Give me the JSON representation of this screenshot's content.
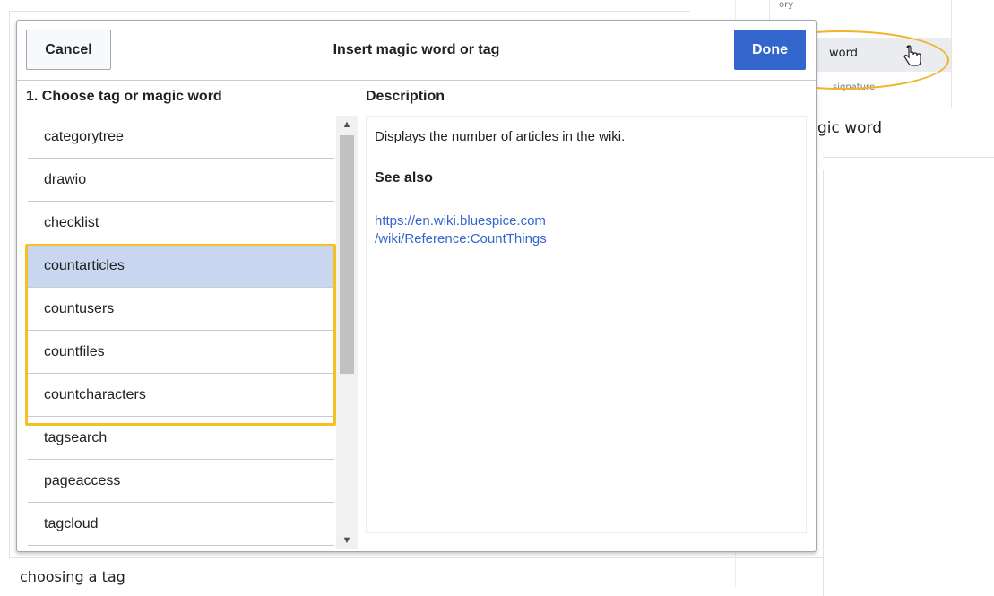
{
  "dialog": {
    "title": "Insert magic word or tag",
    "cancel_label": "Cancel",
    "done_label": "Done",
    "list_heading": "1. Choose tag or magic word",
    "desc_heading": "Description",
    "items": [
      {
        "label": "categorytree",
        "selected": false
      },
      {
        "label": "drawio",
        "selected": false
      },
      {
        "label": "checklist",
        "selected": false
      },
      {
        "label": "countarticles",
        "selected": true
      },
      {
        "label": "countusers",
        "selected": false
      },
      {
        "label": "countfiles",
        "selected": false
      },
      {
        "label": "countcharacters",
        "selected": false
      },
      {
        "label": "tagsearch",
        "selected": false
      },
      {
        "label": "pageaccess",
        "selected": false
      },
      {
        "label": "tagcloud",
        "selected": false
      }
    ],
    "description": "Displays the number of articles in the wiki.",
    "see_also": "See also",
    "link_line1": "https://en.wiki.bluespice.com",
    "link_line2": "/wiki/Reference:CountThings"
  },
  "background": {
    "caption_bottom": "choosing a tag",
    "caption_right": "gic word",
    "menu_top": "ory",
    "menu_word": "word",
    "menu_signature": "signature"
  },
  "colors": {
    "accent": "#3366cc",
    "selection": "#c8d6f0",
    "highlight_border": "#f4c022"
  }
}
